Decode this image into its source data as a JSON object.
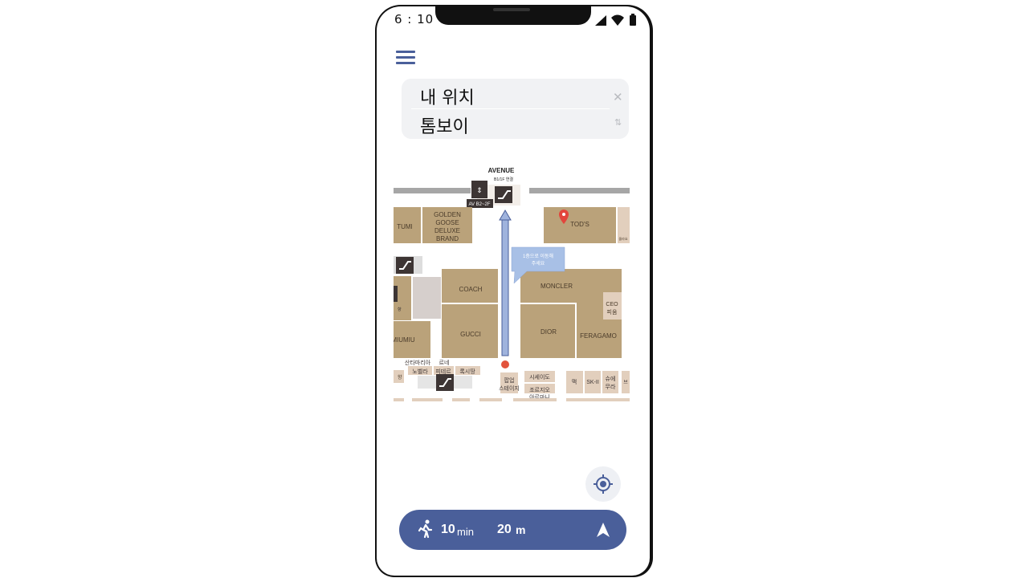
{
  "status_bar": {
    "time": "6 : 10",
    "icons": [
      "signal-icon",
      "wifi-icon",
      "battery-icon"
    ]
  },
  "search": {
    "from": "내 위치",
    "to": "톰보이",
    "clear_icon": "close-icon",
    "swap_icon": "swap-icon"
  },
  "map": {
    "top_label": "AVENUE",
    "connect_label": "B1/1F 연결",
    "elevator_label": "AV B2~2F",
    "stores": {
      "tumi": "TUMI",
      "golden_goose": [
        "GOLDEN",
        "GOOSE",
        "DELUXE",
        "BRAND"
      ],
      "tods": "TOD'S",
      "side_small": "몰라요",
      "coach": "COACH",
      "gucci": "GUCCI",
      "miumiu": "MIUMIU",
      "moncler": "MONCLER",
      "dior": "DIOR",
      "feragamo": "FERAGAMO",
      "ceo": [
        "CEO",
        "피움"
      ],
      "row_left_1": "산타마리아",
      "row_left_2": "노벨라",
      "row_left_3": "르네",
      "row_left_4": "피테르",
      "row_left_5": "록시땅",
      "row_left_6": "향",
      "left_mid_label": "향",
      "popup": [
        "팝업",
        "스테이지"
      ],
      "shiseido": "시세이도",
      "jo_malone": "조르지오",
      "armani": "아르마니",
      "mac": "맥",
      "sk2": "SK-II",
      "uemura": [
        "슈에",
        "무라"
      ],
      "edge": "브"
    },
    "tooltip": [
      "1층으로 이동해",
      "주세요"
    ],
    "colors": {
      "store": "#baa27a",
      "store_light": "#e2cfbd",
      "store_gray": "#d6cfcc",
      "route": "#9fb3dd",
      "route_edge": "#4a5f9a",
      "pin": "#e2453c",
      "start": "#e2533c",
      "icon_bg": "#3d3534"
    },
    "icons": [
      "escalator-icon",
      "elevator-icon",
      "location-pin-icon",
      "current-location-dot"
    ]
  },
  "locate_button": {
    "icon": "crosshair-icon"
  },
  "route_bar": {
    "walk_icon": "walking-icon",
    "time_value": "10",
    "time_unit": "min",
    "distance_value": "20",
    "distance_unit": "m",
    "nav_icon": "navigation-arrow-icon",
    "color": "#4a5f9a"
  }
}
